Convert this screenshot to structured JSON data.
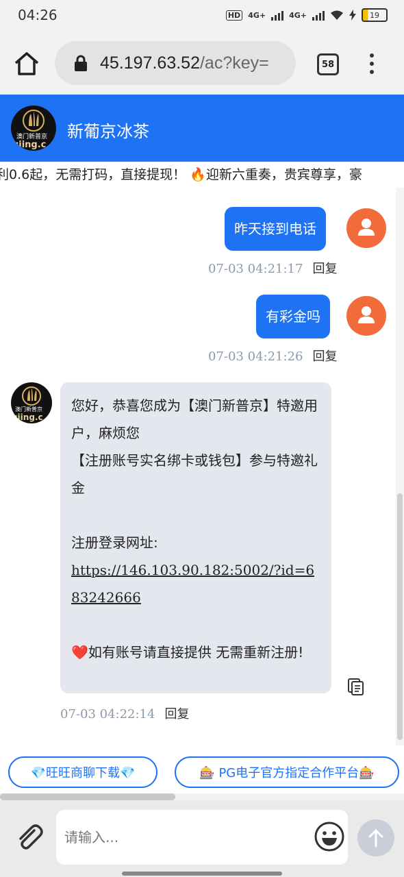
{
  "status_bar": {
    "time": "04:26",
    "hd_label": "HD",
    "net1": "4G+",
    "net2": "4G+",
    "battery": "19"
  },
  "browser": {
    "url_host": "45.197.63.52",
    "url_rest": "/ac?key=",
    "tab_count": "58"
  },
  "chat_header": {
    "title": "新葡京冰茶",
    "logo_text": "澳门新普京",
    "logo_url": "ujing.c"
  },
  "marquee": {
    "text": "利0.6起，无需打码，直接提现！ 🔥迎新六重奏，贵宾尊享，豪"
  },
  "messages": [
    {
      "text": "昨天接到电话",
      "time": "07-03 04:21:17",
      "reply": "回复"
    },
    {
      "text": "有彩金吗",
      "time": "07-03 04:21:26",
      "reply": "回复"
    },
    {
      "line1": "您好，恭喜您成为【澳门新普京】特邀用户，麻烦您",
      "line2": "【注册账号实名绑卡或钱包】参与特邀礼金",
      "line3": "注册登录网址:",
      "link": "https://146.103.90.182:5002/?id=683242666",
      "line4": "❤️如有账号请直接提供 无需重新注册!",
      "time": "07-03 04:22:14",
      "reply": "回复",
      "avatar_text": "澳门新普京",
      "avatar_url": "ujing.c"
    }
  ],
  "quick_buttons": [
    {
      "label": "💎旺旺商聊下载💎"
    },
    {
      "label": "🎰 PG电子官方指定合作平台🎰"
    }
  ],
  "input": {
    "placeholder": "请输入..."
  },
  "colors": {
    "primary": "#1e73f5",
    "user_avatar": "#f26b3a",
    "bot_bubble": "#e4e8ee"
  }
}
